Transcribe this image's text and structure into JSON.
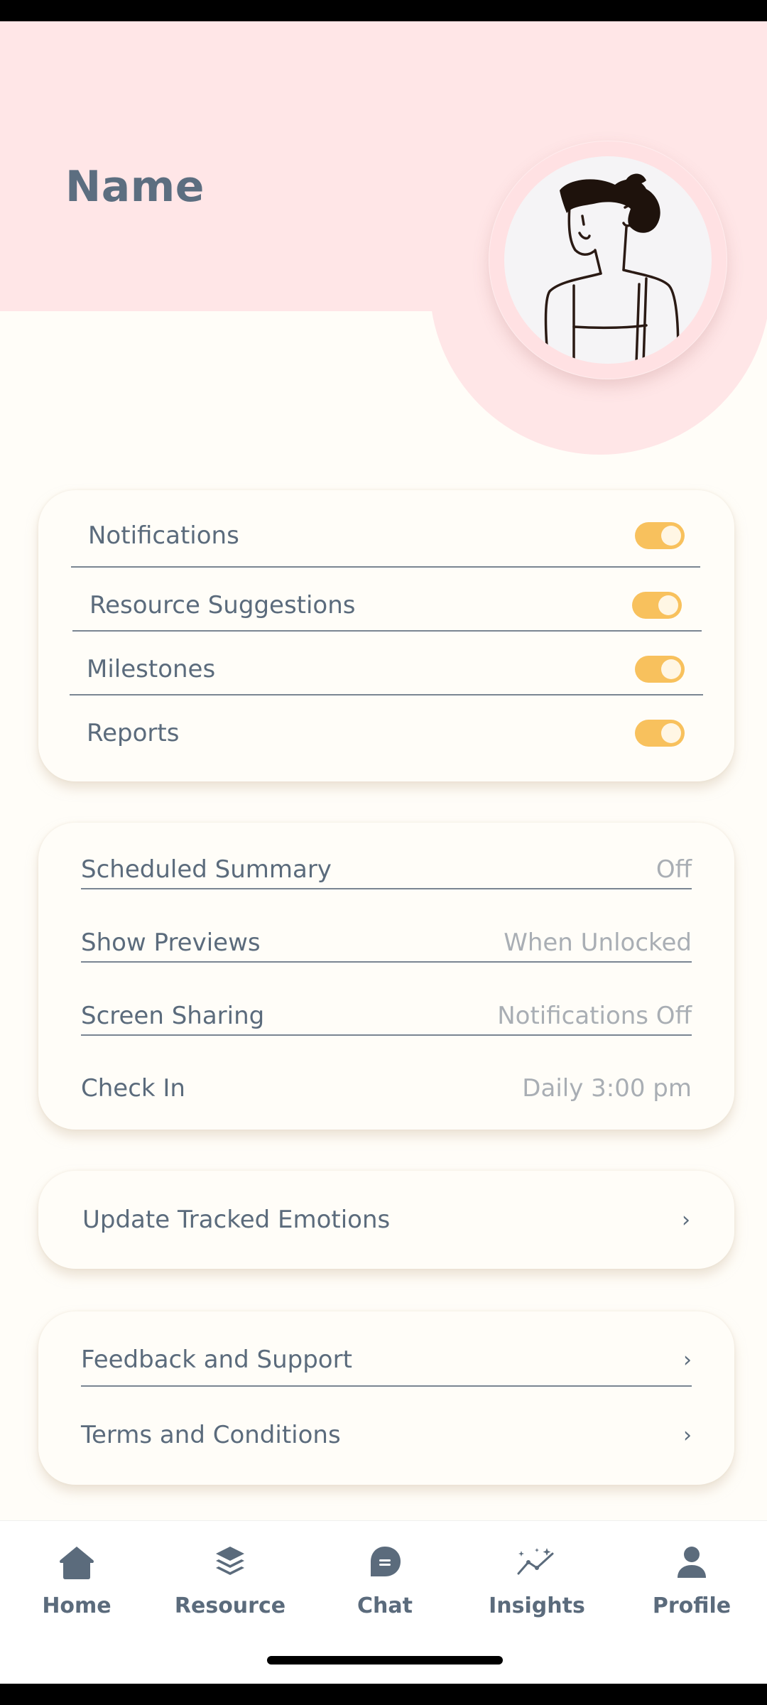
{
  "profile": {
    "name": "Name"
  },
  "notifications_card": {
    "items": [
      {
        "label": "Notifications",
        "enabled": true
      },
      {
        "label": "Resource Suggestions",
        "enabled": true
      },
      {
        "label": "Milestones",
        "enabled": true
      },
      {
        "label": "Reports",
        "enabled": true
      }
    ]
  },
  "settings_card": {
    "items": [
      {
        "label": "Scheduled Summary",
        "value": "Off"
      },
      {
        "label": "Show Previews",
        "value": "When Unlocked"
      },
      {
        "label": "Screen Sharing",
        "value": "Notifications Off"
      },
      {
        "label": "Check In",
        "value": "Daily 3:00 pm"
      }
    ]
  },
  "emotions_card": {
    "label": "Update Tracked Emotions",
    "chevron": "chevron-right-icon"
  },
  "support_card": {
    "items": [
      {
        "label": "Feedback and Support",
        "chevron": "chevron-right-icon"
      },
      {
        "label": "Terms and Conditions",
        "chevron": "chevron-right-icon"
      }
    ]
  },
  "nav": {
    "items": [
      {
        "label": "Home",
        "icon": "home-icon"
      },
      {
        "label": "Resource",
        "icon": "layers-icon"
      },
      {
        "label": "Chat",
        "icon": "chat-icon"
      },
      {
        "label": "Insights",
        "icon": "insights-icon"
      },
      {
        "label": "Profile",
        "icon": "profile-icon"
      }
    ]
  },
  "colors": {
    "header_pink": "#FFE6E7",
    "background": "#FFFDF8",
    "toggle_on": "#F8C15D",
    "text": "#5B6B7C",
    "value_text": "#A9AEB4"
  }
}
